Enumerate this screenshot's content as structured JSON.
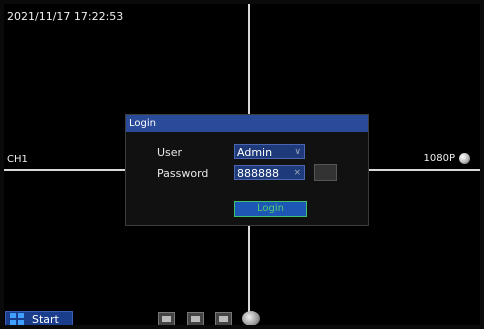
{
  "osd": {
    "datetime": "2021/11/17 17:22:53",
    "channel": "CH1",
    "resolution": "1080P"
  },
  "login_dialog": {
    "title": "Login",
    "user_label": "User",
    "user_value": "Admin",
    "password_label": "Password",
    "password_value": "888888",
    "login_button": "Login"
  },
  "taskbar": {
    "start_label": "Start"
  },
  "icons": {
    "user_dropdown": "chevron-down-icon",
    "password_clear": "close-icon",
    "resolution_indicator": "status-ball-icon",
    "start": "windows-start-icon"
  },
  "colors": {
    "title_bar": "#2a4a9a",
    "field_bg": "#1e3a7a",
    "login_text": "#4fd06f",
    "start_bg": "#1a3e8c"
  }
}
